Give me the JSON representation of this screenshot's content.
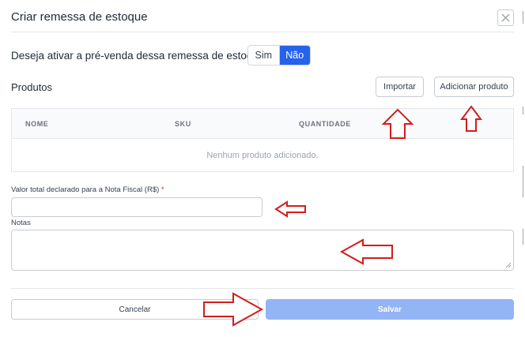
{
  "modal": {
    "title": "Criar remessa de estoque"
  },
  "presale": {
    "question": "Deseja ativar a pré-venda dessa remessa de estoque?",
    "option_yes": "Sim",
    "option_no": "Não",
    "selected": "Não"
  },
  "products": {
    "label": "Produtos",
    "import_button": "Importar",
    "add_button": "Adicionar produto",
    "columns": [
      "NOME",
      "SKU",
      "QUANTIDADE"
    ],
    "empty_message": "Nenhum produto adicionado."
  },
  "form": {
    "declared_value_label": "Valor total declarado para a Nota Fiscal (R$)",
    "required_mark": "*",
    "declared_value": "",
    "notes_label": "Notas",
    "notes_value": ""
  },
  "footer": {
    "cancel_label": "Cancelar",
    "save_label": "Salvar"
  },
  "icons": {
    "close": "close-icon"
  },
  "colors": {
    "primary": "#2563eb",
    "primary_disabled": "#93b4f5",
    "annotation": "#d41c1c"
  }
}
